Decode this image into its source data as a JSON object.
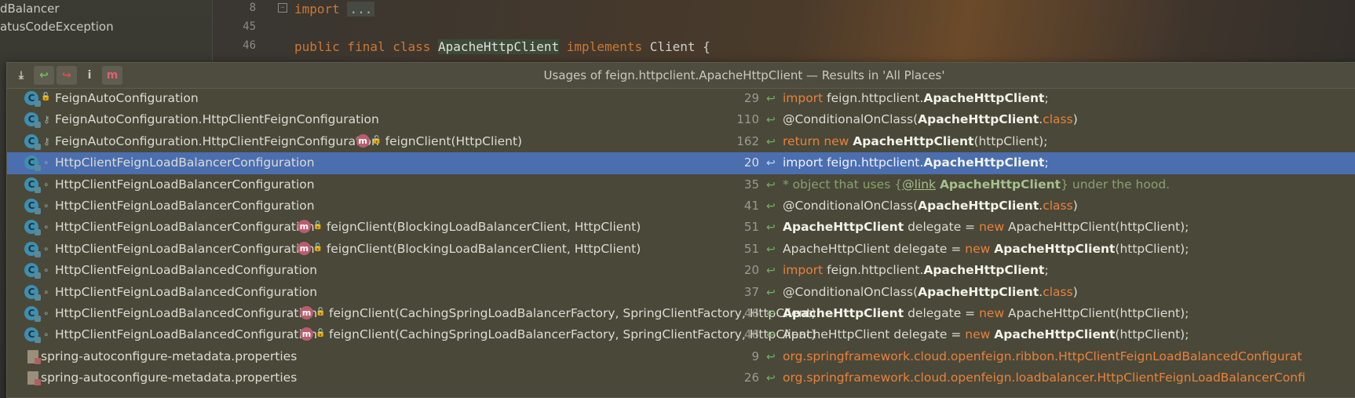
{
  "project_tree": {
    "items": [
      "dBalancer",
      "atusCodeException"
    ]
  },
  "editor": {
    "lines": [
      {
        "number": "8",
        "parts": [
          {
            "t": "import",
            "c": "kw"
          },
          {
            "t": " ",
            "c": ""
          },
          {
            "t": "...",
            "c": "fold"
          }
        ]
      },
      {
        "number": "45",
        "parts": []
      },
      {
        "number": "46",
        "parts": [
          {
            "t": "public final class ",
            "c": "kw"
          },
          {
            "t": "ApacheHttpClient",
            "c": "cls"
          },
          {
            "t": " implements ",
            "c": "kw"
          },
          {
            "t": "Client {",
            "c": ""
          }
        ]
      }
    ]
  },
  "popup": {
    "title": "Usages of feign.httpclient.ApacheHttpClient — Results in 'All Places'",
    "toolbar": [
      {
        "name": "expand-all-icon",
        "glyph": "⤓",
        "color": "#c8c8c0",
        "active": false
      },
      {
        "name": "navigate-prev-usage-icon",
        "glyph": "↩",
        "color": "#6fbf5f",
        "active": true
      },
      {
        "name": "navigate-next-usage-icon",
        "glyph": "↪",
        "color": "#e05050",
        "active": true
      },
      {
        "name": "info-icon",
        "glyph": "i",
        "color": "#c8c8c0",
        "active": false
      },
      {
        "name": "method-filter-icon",
        "glyph": "m",
        "color": "#e06070",
        "active": true
      }
    ],
    "rows": [
      {
        "kind": "class",
        "vis": "lock",
        "name": "FeignAutoConfiguration",
        "method": "",
        "line": "29",
        "snippet": [
          {
            "t": "import",
            "c": "kw"
          },
          {
            "t": " feign.httpclient.",
            "c": ""
          },
          {
            "t": "ApacheHttpClient",
            "c": "b"
          },
          {
            "t": ";",
            "c": ""
          }
        ]
      },
      {
        "kind": "class",
        "vis": "key",
        "name": "FeignAutoConfiguration.HttpClientFeignConfiguration",
        "method": "",
        "line": "110",
        "snippet": [
          {
            "t": "@ConditionalOnClass(",
            "c": ""
          },
          {
            "t": "ApacheHttpClient",
            "c": "b"
          },
          {
            "t": ".",
            "c": ""
          },
          {
            "t": "class",
            "c": "kw"
          },
          {
            "t": ")",
            "c": ""
          }
        ]
      },
      {
        "kind": "class",
        "vis": "key",
        "name": "FeignAutoConfiguration.HttpClientFeignConfiguration",
        "method": "feignClient(HttpClient)",
        "line": "162",
        "snippet": [
          {
            "t": "return new ",
            "c": "kw"
          },
          {
            "t": "ApacheHttpClient",
            "c": "b"
          },
          {
            "t": "(httpClient);",
            "c": ""
          }
        ]
      },
      {
        "kind": "class",
        "vis": "dot",
        "name": "HttpClientFeignLoadBalancerConfiguration",
        "method": "",
        "line": "20",
        "selected": true,
        "snippet": [
          {
            "t": "import feign.httpclient.",
            "c": ""
          },
          {
            "t": "ApacheHttpClient",
            "c": "b"
          },
          {
            "t": ";",
            "c": ""
          }
        ]
      },
      {
        "kind": "class",
        "vis": "dot",
        "name": "HttpClientFeignLoadBalancerConfiguration",
        "method": "",
        "line": "35",
        "snippet": [
          {
            "t": "* object that uses {",
            "c": "cm"
          },
          {
            "t": "@link",
            "c": "cmu"
          },
          {
            "t": " ",
            "c": "cm"
          },
          {
            "t": "ApacheHttpClient",
            "c": "cmb"
          },
          {
            "t": "} under the hood.",
            "c": "cm"
          }
        ]
      },
      {
        "kind": "class",
        "vis": "dot",
        "name": "HttpClientFeignLoadBalancerConfiguration",
        "method": "",
        "line": "41",
        "snippet": [
          {
            "t": "@ConditionalOnClass(",
            "c": ""
          },
          {
            "t": "ApacheHttpClient",
            "c": "b"
          },
          {
            "t": ".",
            "c": ""
          },
          {
            "t": "class",
            "c": "kw"
          },
          {
            "t": ")",
            "c": ""
          }
        ]
      },
      {
        "kind": "class",
        "vis": "dot",
        "name": "HttpClientFeignLoadBalancerConfiguration",
        "method": "feignClient(BlockingLoadBalancerClient, HttpClient)",
        "line": "51",
        "snippet": [
          {
            "t": "ApacheHttpClient",
            "c": "b"
          },
          {
            "t": " delegate = ",
            "c": ""
          },
          {
            "t": "new",
            "c": "kw"
          },
          {
            "t": " ApacheHttpClient(httpClient);",
            "c": ""
          }
        ]
      },
      {
        "kind": "class",
        "vis": "dot",
        "name": "HttpClientFeignLoadBalancerConfiguration",
        "method": "feignClient(BlockingLoadBalancerClient, HttpClient)",
        "line": "51",
        "snippet": [
          {
            "t": "ApacheHttpClient delegate = ",
            "c": ""
          },
          {
            "t": "new",
            "c": "kw"
          },
          {
            "t": " ",
            "c": ""
          },
          {
            "t": "ApacheHttpClient",
            "c": "b"
          },
          {
            "t": "(httpClient);",
            "c": ""
          }
        ]
      },
      {
        "kind": "class",
        "vis": "dot",
        "name": "HttpClientFeignLoadBalancedConfiguration",
        "method": "",
        "line": "20",
        "snippet": [
          {
            "t": "import",
            "c": "kw"
          },
          {
            "t": " feign.httpclient.",
            "c": ""
          },
          {
            "t": "ApacheHttpClient",
            "c": "b"
          },
          {
            "t": ";",
            "c": ""
          }
        ]
      },
      {
        "kind": "class",
        "vis": "dot",
        "name": "HttpClientFeignLoadBalancedConfiguration",
        "method": "",
        "line": "37",
        "snippet": [
          {
            "t": "@ConditionalOnClass(",
            "c": ""
          },
          {
            "t": "ApacheHttpClient",
            "c": "b"
          },
          {
            "t": ".",
            "c": ""
          },
          {
            "t": "class",
            "c": "kw"
          },
          {
            "t": ")",
            "c": ""
          }
        ]
      },
      {
        "kind": "class",
        "vis": "dot",
        "name": "HttpClientFeignLoadBalancedConfiguration",
        "method": "feignClient(CachingSpringLoadBalancerFactory, SpringClientFactory, HttpClient)",
        "line": "46",
        "snippet": [
          {
            "t": "ApacheHttpClient",
            "c": "b"
          },
          {
            "t": " delegate = ",
            "c": ""
          },
          {
            "t": "new",
            "c": "kw"
          },
          {
            "t": " ApacheHttpClient(httpClient);",
            "c": ""
          }
        ]
      },
      {
        "kind": "class",
        "vis": "dot",
        "name": "HttpClientFeignLoadBalancedConfiguration",
        "method": "feignClient(CachingSpringLoadBalancerFactory, SpringClientFactory, HttpClient)",
        "line": "46",
        "snippet": [
          {
            "t": "ApacheHttpClient delegate = ",
            "c": ""
          },
          {
            "t": "new",
            "c": "kw"
          },
          {
            "t": " ",
            "c": ""
          },
          {
            "t": "ApacheHttpClient",
            "c": "b"
          },
          {
            "t": "(httpClient);",
            "c": ""
          }
        ]
      },
      {
        "kind": "file",
        "vis": "",
        "name": "spring-autoconfigure-metadata.properties",
        "method": "",
        "line": "9",
        "snippet": [
          {
            "t": "org.springframework.cloud.openfeign.ribbon.HttpClientFeignLoadBalancedConfigurat",
            "c": "orange"
          }
        ]
      },
      {
        "kind": "file",
        "vis": "",
        "name": "spring-autoconfigure-metadata.properties",
        "method": "",
        "line": "26",
        "snippet": [
          {
            "t": "org.springframework.cloud.openfeign.loadbalancer.HttpClientFeignLoadBalancerConfi",
            "c": "orange"
          }
        ]
      }
    ]
  },
  "icons": {
    "class_glyph": "C",
    "method_glyph": "m",
    "usage_glyph": "↩",
    "lock_glyph": "🔓",
    "key_glyph": "⚷",
    "dot_glyph": "∘",
    "fold_glyph": "−"
  }
}
